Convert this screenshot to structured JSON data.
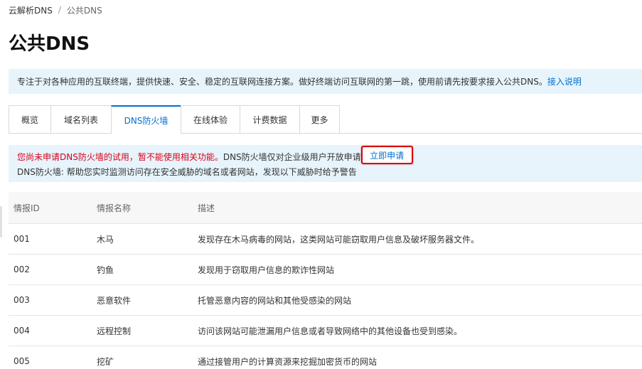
{
  "breadcrumb": {
    "root": "云解析DNS",
    "separator": "/",
    "current": "公共DNS"
  },
  "page": {
    "title": "公共DNS"
  },
  "intro": {
    "text": "专注于对各种应用的互联终端，提供快速、安全、稳定的互联网连接方案。做好终端访问互联网的第一跳，使用前请先按要求接入公共DNS。",
    "link": "接入说明"
  },
  "tabs": [
    {
      "label": "概览"
    },
    {
      "label": "域名列表"
    },
    {
      "label": "DNS防火墙"
    },
    {
      "label": "在线体验"
    },
    {
      "label": "计费数据"
    },
    {
      "label": "更多"
    }
  ],
  "notice": {
    "warning": "您尚未申请DNS防火墙的试用，暂不能使用相关功能。",
    "info": "DNS防火墙仅对企业级用户开放申请",
    "apply_button": "立即申请",
    "description": "DNS防火墙: 帮助您实时监测访问存在安全威胁的域名或者网站，发现以下威胁时给予警告"
  },
  "table": {
    "headers": [
      "情报ID",
      "情报名称",
      "描述"
    ],
    "rows": [
      {
        "id": "001",
        "name": "木马",
        "desc": "发现存在木马病毒的网站，这类网站可能窃取用户信息及破坏服务器文件。"
      },
      {
        "id": "002",
        "name": "钓鱼",
        "desc": "发现用于窃取用户信息的欺诈性网站"
      },
      {
        "id": "003",
        "name": "恶意软件",
        "desc": "托管恶意内容的网站和其他受感染的网站"
      },
      {
        "id": "004",
        "name": "远程控制",
        "desc": "访问该网站可能泄漏用户信息或者导致网络中的其他设备也受到感染。"
      },
      {
        "id": "005",
        "name": "挖矿",
        "desc": "通过接管用户的计算资源来挖掘加密货币的网站"
      }
    ]
  },
  "colors": {
    "accent": "#0070cc",
    "warning": "#d9001b",
    "info_bg": "#e7f4fb",
    "highlight_border": "#d40000"
  }
}
